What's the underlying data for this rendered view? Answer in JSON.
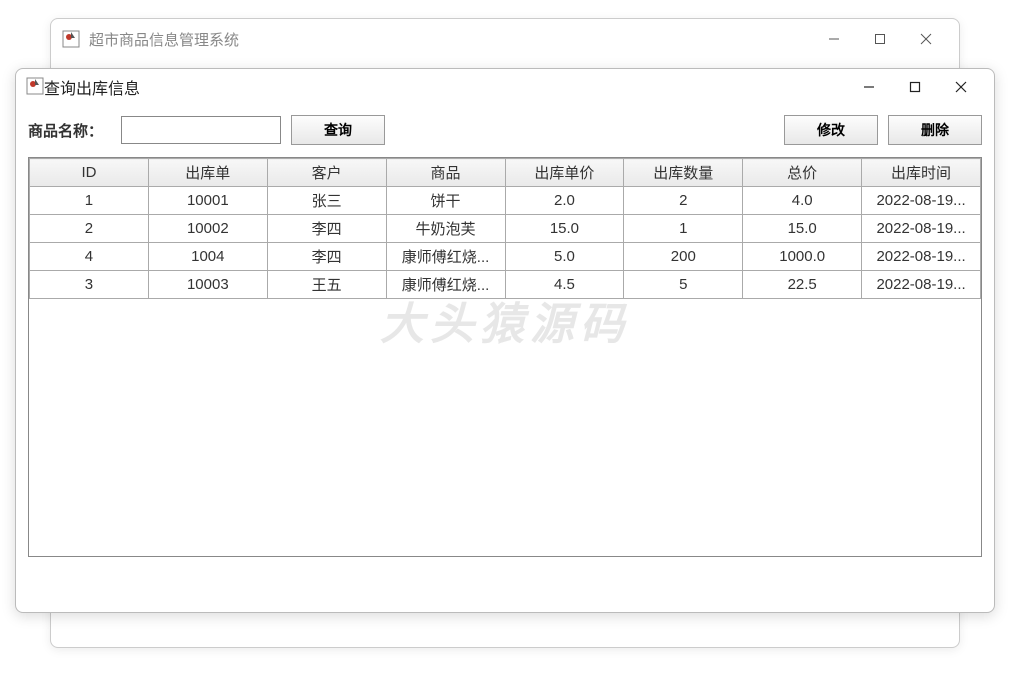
{
  "outer_window": {
    "title": "超市商品信息管理系统"
  },
  "inner_window": {
    "title": "查询出库信息"
  },
  "toolbar": {
    "label": "商品名称：",
    "input_value": "",
    "search_label": "查询",
    "edit_label": "修改",
    "delete_label": "删除"
  },
  "table": {
    "headers": [
      "ID",
      "出库单",
      "客户",
      "商品",
      "出库单价",
      "出库数量",
      "总价",
      "出库时间"
    ],
    "rows": [
      [
        "1",
        "10001",
        "张三",
        "饼干",
        "2.0",
        "2",
        "4.0",
        "2022-08-19..."
      ],
      [
        "2",
        "10002",
        "李四",
        "牛奶泡芙",
        "15.0",
        "1",
        "15.0",
        "2022-08-19..."
      ],
      [
        "4",
        "1004",
        "李四",
        "康师傅红烧...",
        "5.0",
        "200",
        "1000.0",
        "2022-08-19..."
      ],
      [
        "3",
        "10003",
        "王五",
        "康师傅红烧...",
        "4.5",
        "5",
        "22.5",
        "2022-08-19..."
      ]
    ]
  },
  "watermark": "大头猿源码"
}
